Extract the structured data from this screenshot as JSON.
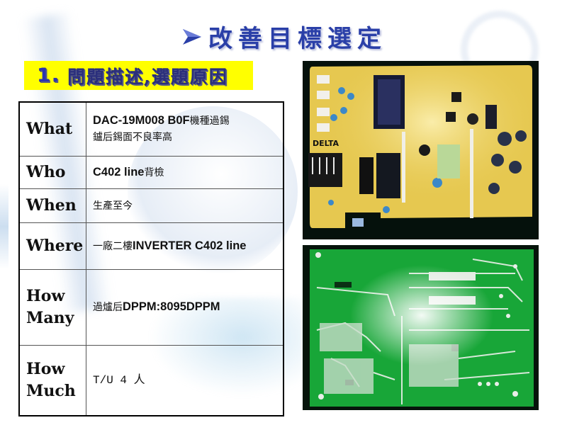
{
  "slide": {
    "title": "改善目標選定",
    "title_icon": "arrow-bullet-icon",
    "subtitle_number": "1.",
    "subtitle_text": "問題描述,選題原因",
    "colors": {
      "title": "#2a3fa8",
      "banner_bg": "#ffff00",
      "banner_text": "#2b2f7c"
    }
  },
  "table": {
    "rows": [
      {
        "key": "What",
        "value_parts": [
          {
            "text": "DAC-19M008 B0F",
            "style": "bold"
          },
          {
            "text": "機種過錫",
            "style": "zh"
          },
          {
            "text": "鑪后錫面不良率高",
            "style": "zh",
            "newline": true
          }
        ]
      },
      {
        "key": "Who",
        "value_parts": [
          {
            "text": "C402 line",
            "style": "bold"
          },
          {
            "text": "背檢",
            "style": "zh"
          }
        ]
      },
      {
        "key": "When",
        "value_parts": [
          {
            "text": "生產至今",
            "style": "zh"
          }
        ]
      },
      {
        "key": "Where",
        "value_parts": [
          {
            "text": "一廠二樓",
            "style": "zh"
          },
          {
            "text": "INVERTER C402 line",
            "style": "bold"
          }
        ]
      },
      {
        "key": "How Many",
        "value_parts": [
          {
            "text": "過爐后",
            "style": "zh"
          },
          {
            "text": "DPPM:8095DPPM",
            "style": "bold"
          }
        ]
      },
      {
        "key": "How Much",
        "value_parts": [
          {
            "text": "T/U 4 人",
            "style": "mono"
          }
        ]
      }
    ]
  },
  "photos": {
    "top": {
      "subject": "pcb-component-side",
      "brand_text": "DELTA"
    },
    "bottom": {
      "subject": "pcb-solder-side"
    }
  }
}
